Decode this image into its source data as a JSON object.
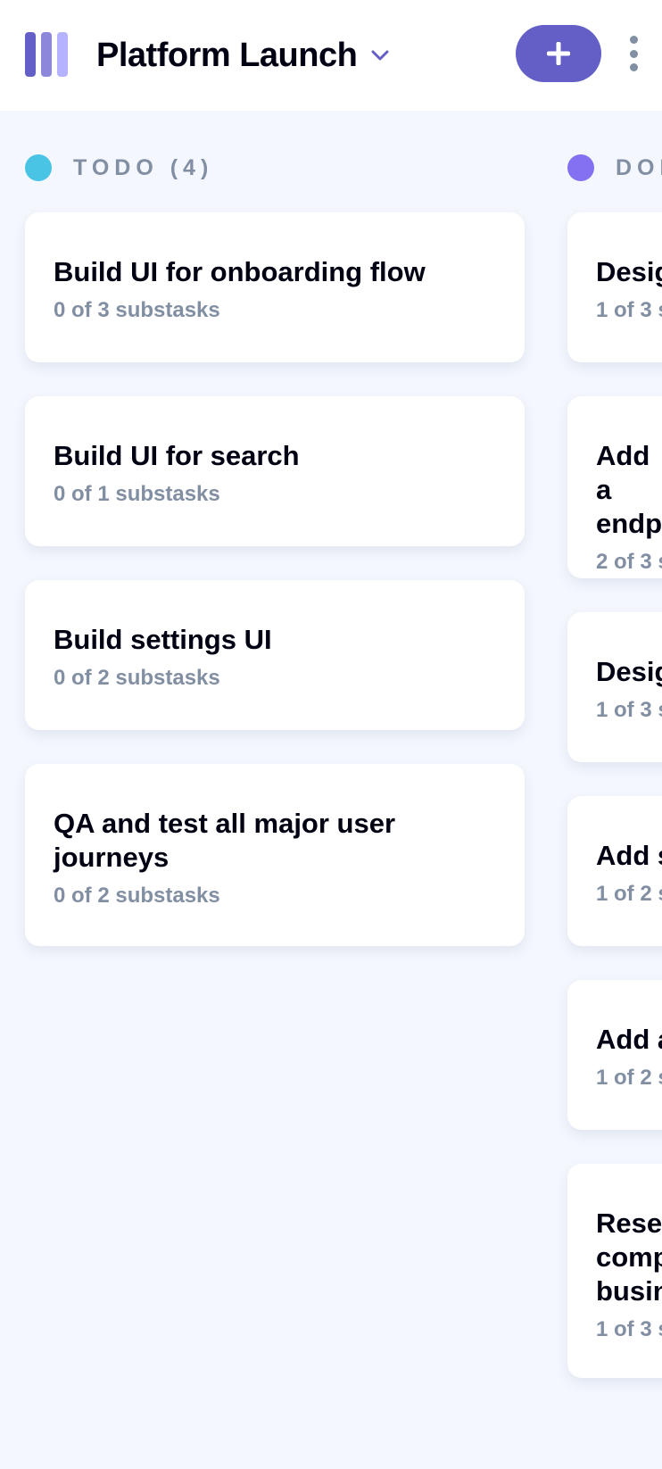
{
  "header": {
    "board_name": "Platform Launch",
    "add_task_icon": "plus-icon",
    "menu_icon": "vertical-ellipsis-icon"
  },
  "colors": {
    "accent": "#635FC7",
    "todo_dot": "#49C4E5",
    "doing_dot": "#8471F2",
    "card_title": "#000112",
    "muted": "#828FA3",
    "background": "#F4F7FD"
  },
  "columns": [
    {
      "title": "TODO (4)",
      "cards": [
        {
          "title": "Build UI for onboarding flow",
          "subtasks": "0 of 3 substasks"
        },
        {
          "title": "Build UI for search",
          "subtasks": "0 of 1 substasks"
        },
        {
          "title": "Build settings UI",
          "subtasks": "0 of 2 substasks"
        },
        {
          "title": "QA and test all major user journeys",
          "subtasks": "0 of 2 substasks"
        }
      ]
    },
    {
      "title": "DOI",
      "cards": [
        {
          "title": "Desig",
          "subtasks": "1 of 3 s"
        },
        {
          "title": "Add a endp",
          "subtasks": "2 of 3 s"
        },
        {
          "title": "Desig",
          "subtasks": "1 of 3 s"
        },
        {
          "title": "Add s",
          "subtasks": "1 of 2 s"
        },
        {
          "title": "Add a",
          "subtasks": "1 of 2 s"
        },
        {
          "title": "Resea comp busin",
          "subtasks": "1 of 3 s"
        }
      ]
    }
  ]
}
